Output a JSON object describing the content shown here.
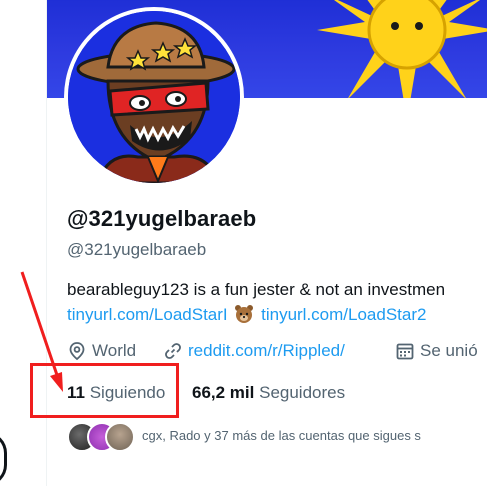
{
  "profile": {
    "display_handle": "@321yugelbaraeb",
    "handle": "@321yugelbaraeb",
    "bio_line1": "bearableguy123 is a fun jester & not an investmen",
    "bio_link1": "tinyurl.com/LoadStarI",
    "bio_link2": "tinyurl.com/LoadStar2",
    "location": "World",
    "website": "reddit.com/r/Rippled/",
    "joined": "Se unió"
  },
  "stats": {
    "following_count": "11",
    "following_label": "Siguiendo",
    "followers_count": "66,2 mil",
    "followers_label": "Seguidores"
  },
  "followed_by": {
    "text": "cgx, Rado y 37 más de las cuentas que sigues s"
  },
  "colors": {
    "accent": "#1d9bf0",
    "annotation": "#f01e1e",
    "banner_blue": "#2e3be0",
    "sun_yellow": "#ffd21a"
  },
  "icons": {
    "location": "location-pin-icon",
    "link": "link-icon",
    "calendar": "calendar-icon",
    "bear_emoji": "bear-face-icon"
  }
}
